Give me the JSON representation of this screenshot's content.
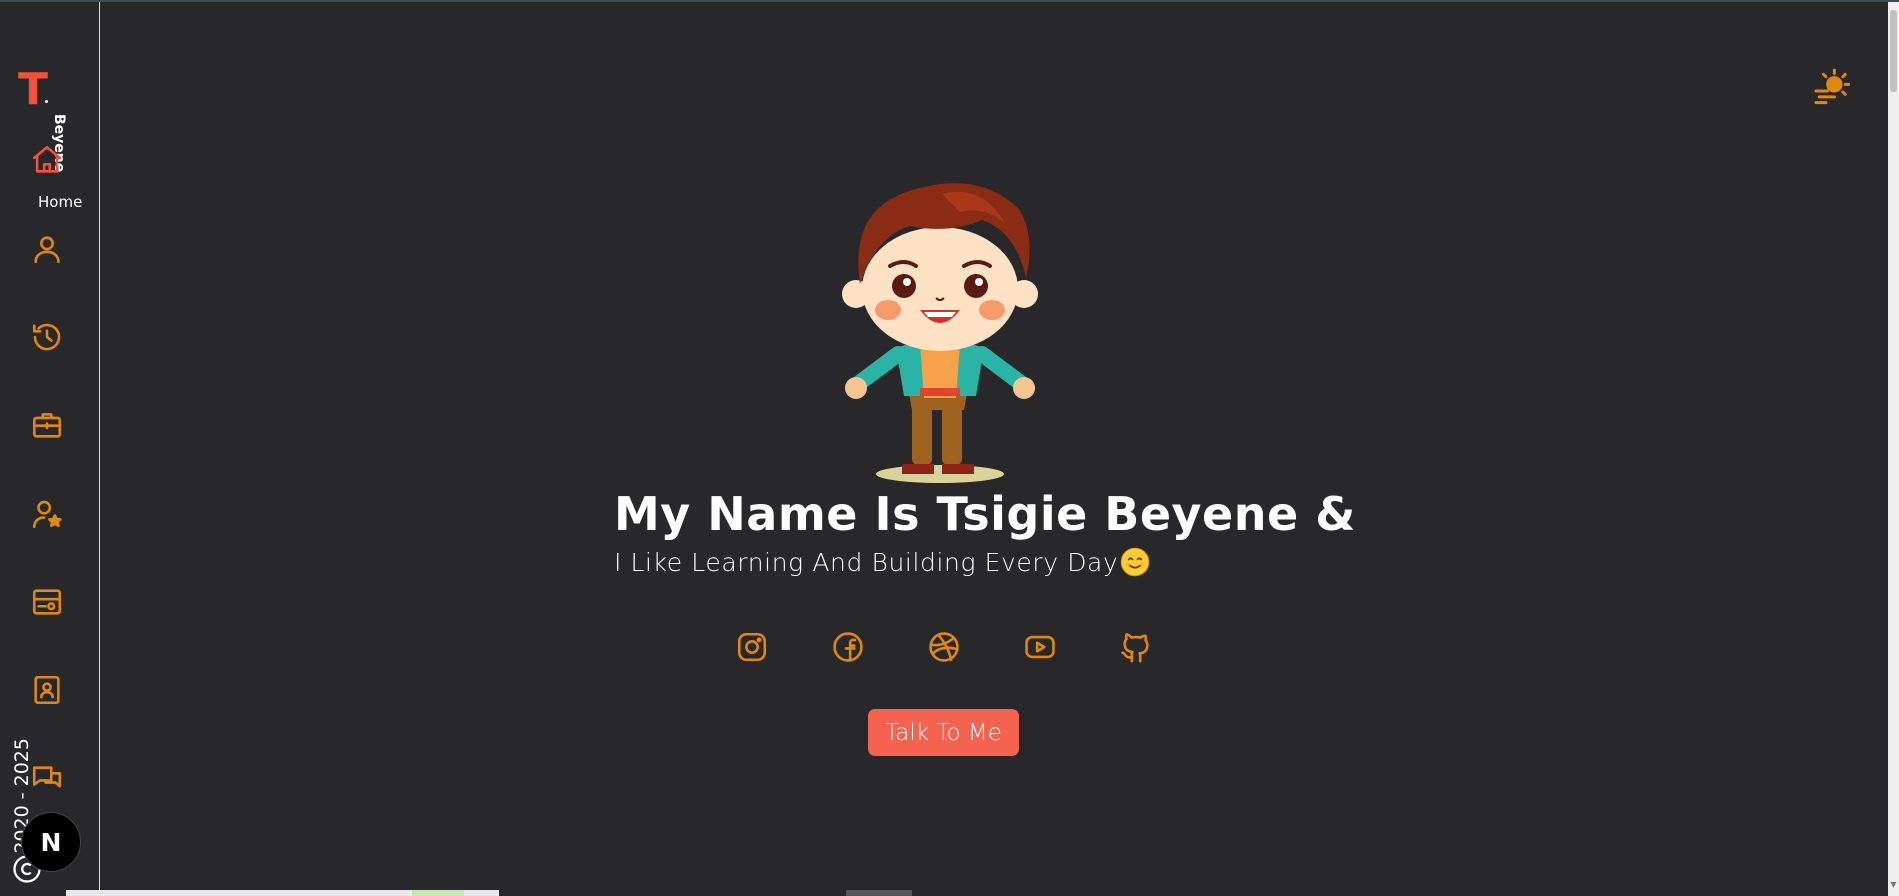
{
  "brand": {
    "logo_letter": "T",
    "name": "Beyene"
  },
  "sidebar": {
    "items": [
      {
        "icon": "home-icon",
        "label": "Home",
        "active": true
      },
      {
        "icon": "user-icon"
      },
      {
        "icon": "history-icon"
      },
      {
        "icon": "briefcase-icon"
      },
      {
        "icon": "user-star-icon"
      },
      {
        "icon": "server-icon"
      },
      {
        "icon": "contact-book-icon"
      },
      {
        "icon": "chat-icon"
      }
    ],
    "copyright": "2020 - 2025",
    "badge": "N"
  },
  "hero": {
    "title": "My Name Is Tsigie Beyene &",
    "subtitle": "I Like Learning And Building Every Day",
    "subtitle_emoji": "smiling-face-emoji"
  },
  "socials": [
    "instagram-icon",
    "facebook-icon",
    "dribbble-icon",
    "youtube-icon",
    "github-icon"
  ],
  "cta": {
    "label": "Talk To Me"
  },
  "theme_toggle": {
    "icon": "sun-icon"
  },
  "colors": {
    "background": "#28282b",
    "accent": "#f4503d",
    "icon": "#e0890f",
    "cta": "#f4634f"
  }
}
